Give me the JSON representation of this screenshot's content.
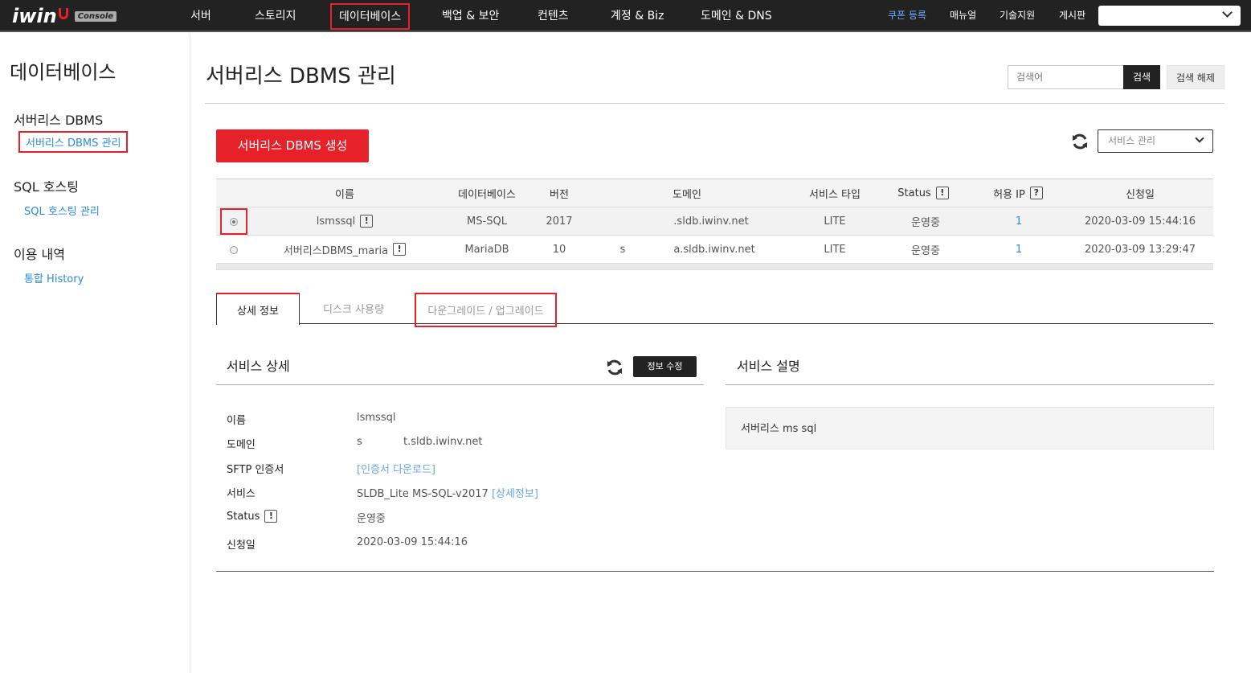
{
  "topnav": {
    "logo_word": "iwin",
    "logo_badge": "Console",
    "items": [
      "서버",
      "스토리지",
      "데이터베이스",
      "백업 & 보안",
      "컨텐츠",
      "계정 & Biz",
      "도메인 & DNS"
    ],
    "util": [
      "쿠폰 등록",
      "매뉴얼",
      "기술지원",
      "게시판"
    ],
    "select_value": ""
  },
  "sidebar": {
    "title": "데이터베이스",
    "groups": [
      {
        "label": "서버리스 DBMS",
        "links": [
          "서버리스 DBMS 관리"
        ]
      },
      {
        "label": "SQL 호스팅",
        "links": [
          "SQL 호스팅 관리"
        ]
      },
      {
        "label": "이용 내역",
        "links": [
          "통합 History"
        ]
      }
    ]
  },
  "header": {
    "title": "서버리스 DBMS 관리",
    "search_placeholder": "검색어",
    "search_btn": "검색",
    "reset_btn": "검색 해제"
  },
  "toolbar": {
    "create_btn": "서버리스 DBMS 생성",
    "svc_select": "서비스 관리"
  },
  "table": {
    "headers": [
      "이름",
      "데이터베이스",
      "버전",
      "도메인",
      "서비스 타입",
      "Status",
      "허용 IP",
      "신청일"
    ],
    "badge_q": "?",
    "badge_ex": "!",
    "rows": [
      {
        "name": "lsmssql",
        "db": "MS-SQL",
        "ver": "2017",
        "dom_prefix": "",
        "domain": ".sldb.iwinv.net",
        "type": "LITE",
        "status": "운영중",
        "ip": "1",
        "date": "2020-03-09 15:44:16"
      },
      {
        "name": "서버리스DBMS_maria",
        "db": "MariaDB",
        "ver": "10",
        "dom_prefix": "s",
        "domain": "a.sldb.iwinv.net",
        "type": "LITE",
        "status": "운영중",
        "ip": "1",
        "date": "2020-03-09 13:29:47"
      }
    ]
  },
  "tabs": [
    "상세 정보",
    "디스크 사용량",
    "다운그레이드 / 업그레이드"
  ],
  "detail": {
    "title": "서비스 상세",
    "edit_btn": "정보 수정",
    "labels": [
      "이름",
      "도메인",
      "SFTP 인증서",
      "서비스",
      "Status",
      "신청일"
    ],
    "name": "lsmssql",
    "domain_prefix": "s",
    "domain": "t.sldb.iwinv.net",
    "sftp": "[인증서 다운로드]",
    "service": "SLDB_Lite MS-SQL-v2017",
    "service_link": "[상세정보]",
    "status": "운영중",
    "date": "2020-03-09 15:44:16"
  },
  "description": {
    "title": "서비스 설명",
    "text": "서버리스 ms sql"
  },
  "colors": {
    "accent": "#e62129",
    "link": "#2e8ad8",
    "topbar": "#222222"
  }
}
